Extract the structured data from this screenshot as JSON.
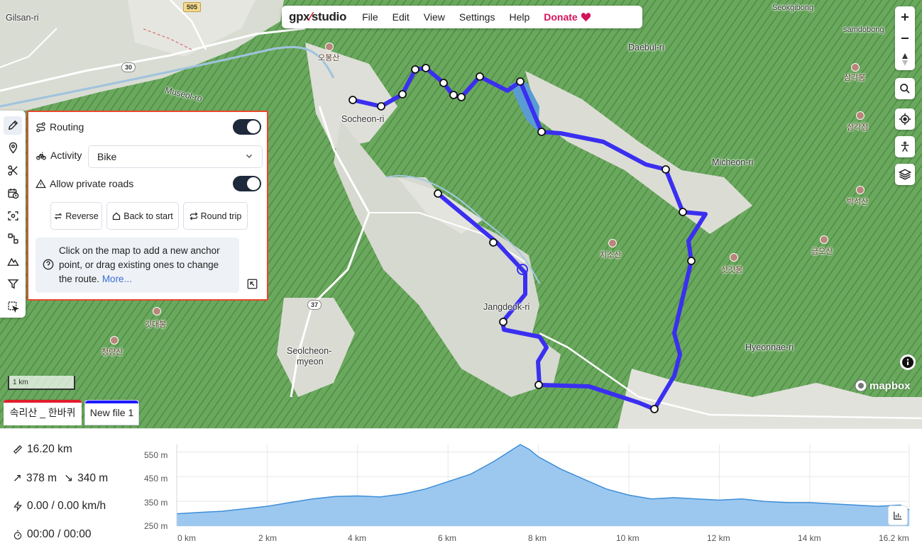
{
  "app": {
    "logo_left": "gpx",
    "logo_right": "studio"
  },
  "menu": [
    {
      "label": "File"
    },
    {
      "label": "Edit"
    },
    {
      "label": "View"
    },
    {
      "label": "Settings"
    },
    {
      "label": "Help"
    },
    {
      "label": "Donate",
      "icon": "heart-icon",
      "color": "#d4145a"
    }
  ],
  "toolbar": [
    {
      "name": "route-tool",
      "icon": "pencil-icon",
      "active": true
    },
    {
      "name": "waypoint-tool",
      "icon": "map-pin-icon"
    },
    {
      "name": "scissors-tool",
      "icon": "scissors-icon"
    },
    {
      "name": "time-tool",
      "icon": "calendar-clock-icon"
    },
    {
      "name": "clean-tool",
      "icon": "scan-icon"
    },
    {
      "name": "merge-tool",
      "icon": "merge-icon"
    },
    {
      "name": "elevation-tool",
      "icon": "mountain-icon"
    },
    {
      "name": "filter-tool",
      "icon": "filter-icon"
    },
    {
      "name": "select-tool",
      "icon": "selection-icon"
    }
  ],
  "panel": {
    "routing_label": "Routing",
    "routing_on": true,
    "activity_label": "Activity",
    "activity_value": "Bike",
    "private_roads_label": "Allow private roads",
    "private_roads_on": true,
    "reverse_label": "Reverse",
    "back_to_start_label": "Back to start",
    "round_trip_label": "Round trip",
    "help_text": "Click on the map to add a new anchor point, or drag existing ones to change the route.",
    "help_more": "More..."
  },
  "map": {
    "labels": {
      "gilsan": "Gilsan-ri",
      "museol": "Museol-ro",
      "osan": "오봉산",
      "socheon": "Socheon-ri",
      "daebul": "Daebul-ri",
      "seokgibong": "Seokgibong",
      "samdobong": "samdobong",
      "samgak1": "삼각봉",
      "samgak2": "삼각점",
      "micheon": "Micheon-ri",
      "baksok": "박석산",
      "geumosan": "금오산",
      "jisosan": "지소산",
      "satgatbong": "삿갓봉",
      "jangdeok": "Jangdeok-ri",
      "seolcheon1": "Seolcheon-",
      "seolcheon2": "myeon",
      "hyeonnae": "Hyeonnae-ri",
      "gitdaebong": "깃대봉",
      "cheongnyang": "청량산"
    },
    "road_shields": {
      "r505": "505",
      "r30": "30",
      "r37": "37"
    },
    "scale": "1 km",
    "attribution": "mapbox",
    "route_color": "#3a2ff0"
  },
  "files": [
    {
      "label": "속리산 _ 한바퀴",
      "color": "#e11d2a"
    },
    {
      "label": "New file 1",
      "color": "#1a1aff"
    }
  ],
  "stats": {
    "distance": "16.20 km",
    "elevation_up": "378 m",
    "elevation_down": "340 m",
    "speed": "0.00 / 0.00 km/h",
    "time": "00:00 / 00:00"
  },
  "chart_data": {
    "type": "area",
    "x": [
      0,
      0.5,
      1,
      1.5,
      2,
      2.5,
      3,
      3.5,
      4,
      4.5,
      5,
      5.5,
      6,
      6.5,
      7,
      7.3,
      7.6,
      7.8,
      8,
      8.5,
      9,
      9.5,
      10,
      10.5,
      11,
      11.5,
      12,
      12.5,
      13,
      13.5,
      14,
      14.5,
      15,
      15.5,
      16,
      16.2
    ],
    "series": [
      {
        "values": [
          300,
          305,
          310,
          320,
          330,
          345,
          360,
          370,
          372,
          368,
          380,
          400,
          430,
          460,
          510,
          545,
          580,
          560,
          530,
          480,
          440,
          400,
          375,
          360,
          365,
          360,
          355,
          360,
          350,
          345,
          345,
          340,
          335,
          330,
          335,
          315
        ]
      }
    ],
    "yticks": [
      "550 m",
      "450 m",
      "350 m",
      "250 m"
    ],
    "xticks": [
      "0 km",
      "2 km",
      "4 km",
      "6 km",
      "8 km",
      "10 km",
      "12 km",
      "14 km",
      "16.2 km"
    ],
    "ylim": [
      250,
      580
    ],
    "xlim": [
      0,
      16.2
    ],
    "fill_color": "#9cc8f0",
    "line_color": "#3d8ed8"
  }
}
